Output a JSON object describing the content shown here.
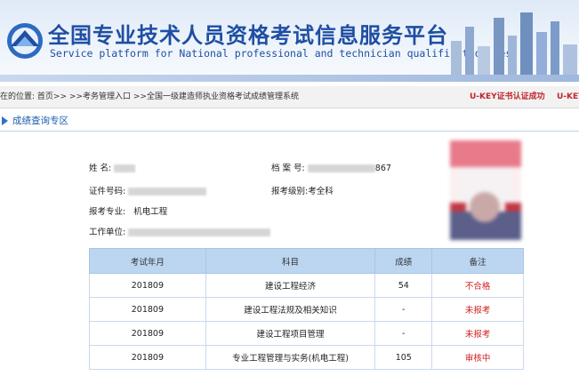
{
  "header": {
    "title_cn": "全国专业技术人员资格考试信息服务平台",
    "title_en": "Service platform for National professional and technician qualification test"
  },
  "breadcrumb": {
    "prefix": "在的位置:",
    "items": [
      "首页>>",
      ">>考务管理入口",
      ">>全国一级建造师执业资格考试成绩管理系统"
    ],
    "ukey_status": "U-KEY证书认证成功",
    "ukey_cut": "U-KEY"
  },
  "section": {
    "title": "成绩查询专区"
  },
  "profile": {
    "name_label": "姓    名:",
    "name_value": "",
    "archive_label": "档 案 号:",
    "archive_value": "867",
    "id_label": "证件号码:",
    "id_value": "",
    "level_label": "报考级别:",
    "level_value": "考全科",
    "major_label": "报考专业:",
    "major_value": "机电工程",
    "work_label": "工作单位:",
    "work_value": ""
  },
  "table": {
    "headers": [
      "考试年月",
      "科目",
      "成绩",
      "备注"
    ],
    "rows": [
      {
        "date": "201809",
        "subject": "建设工程经济",
        "score": "54",
        "note": "不合格"
      },
      {
        "date": "201809",
        "subject": "建设工程法规及相关知识",
        "score": "-",
        "note": "未报考"
      },
      {
        "date": "201809",
        "subject": "建设工程项目管理",
        "score": "-",
        "note": "未报考"
      },
      {
        "date": "201809",
        "subject": "专业工程管理与实务(机电工程)",
        "score": "105",
        "note": "审核中"
      }
    ]
  },
  "colors": {
    "brand": "#1f4ea3",
    "alert": "#d02020",
    "table_header": "#bcd6f2"
  }
}
